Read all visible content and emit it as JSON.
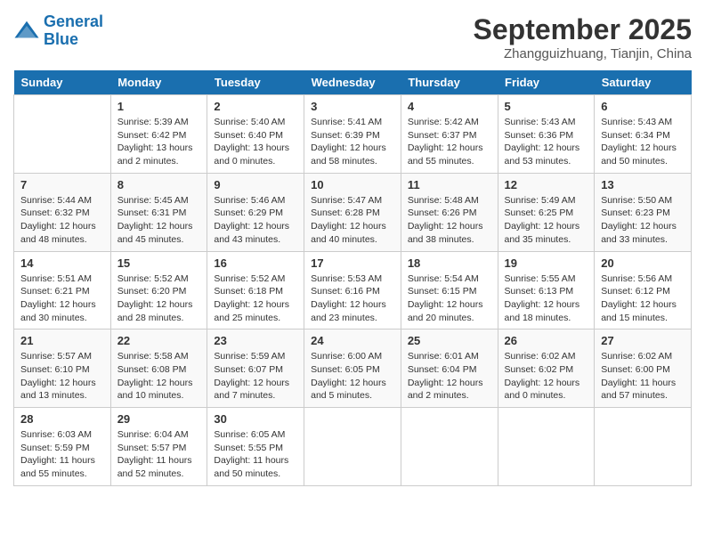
{
  "header": {
    "logo_line1": "General",
    "logo_line2": "Blue",
    "month": "September 2025",
    "location": "Zhangguizhuang, Tianjin, China"
  },
  "days_of_week": [
    "Sunday",
    "Monday",
    "Tuesday",
    "Wednesday",
    "Thursday",
    "Friday",
    "Saturday"
  ],
  "weeks": [
    [
      {
        "day": "",
        "info": ""
      },
      {
        "day": "1",
        "info": "Sunrise: 5:39 AM\nSunset: 6:42 PM\nDaylight: 13 hours\nand 2 minutes."
      },
      {
        "day": "2",
        "info": "Sunrise: 5:40 AM\nSunset: 6:40 PM\nDaylight: 13 hours\nand 0 minutes."
      },
      {
        "day": "3",
        "info": "Sunrise: 5:41 AM\nSunset: 6:39 PM\nDaylight: 12 hours\nand 58 minutes."
      },
      {
        "day": "4",
        "info": "Sunrise: 5:42 AM\nSunset: 6:37 PM\nDaylight: 12 hours\nand 55 minutes."
      },
      {
        "day": "5",
        "info": "Sunrise: 5:43 AM\nSunset: 6:36 PM\nDaylight: 12 hours\nand 53 minutes."
      },
      {
        "day": "6",
        "info": "Sunrise: 5:43 AM\nSunset: 6:34 PM\nDaylight: 12 hours\nand 50 minutes."
      }
    ],
    [
      {
        "day": "7",
        "info": "Sunrise: 5:44 AM\nSunset: 6:32 PM\nDaylight: 12 hours\nand 48 minutes."
      },
      {
        "day": "8",
        "info": "Sunrise: 5:45 AM\nSunset: 6:31 PM\nDaylight: 12 hours\nand 45 minutes."
      },
      {
        "day": "9",
        "info": "Sunrise: 5:46 AM\nSunset: 6:29 PM\nDaylight: 12 hours\nand 43 minutes."
      },
      {
        "day": "10",
        "info": "Sunrise: 5:47 AM\nSunset: 6:28 PM\nDaylight: 12 hours\nand 40 minutes."
      },
      {
        "day": "11",
        "info": "Sunrise: 5:48 AM\nSunset: 6:26 PM\nDaylight: 12 hours\nand 38 minutes."
      },
      {
        "day": "12",
        "info": "Sunrise: 5:49 AM\nSunset: 6:25 PM\nDaylight: 12 hours\nand 35 minutes."
      },
      {
        "day": "13",
        "info": "Sunrise: 5:50 AM\nSunset: 6:23 PM\nDaylight: 12 hours\nand 33 minutes."
      }
    ],
    [
      {
        "day": "14",
        "info": "Sunrise: 5:51 AM\nSunset: 6:21 PM\nDaylight: 12 hours\nand 30 minutes."
      },
      {
        "day": "15",
        "info": "Sunrise: 5:52 AM\nSunset: 6:20 PM\nDaylight: 12 hours\nand 28 minutes."
      },
      {
        "day": "16",
        "info": "Sunrise: 5:52 AM\nSunset: 6:18 PM\nDaylight: 12 hours\nand 25 minutes."
      },
      {
        "day": "17",
        "info": "Sunrise: 5:53 AM\nSunset: 6:16 PM\nDaylight: 12 hours\nand 23 minutes."
      },
      {
        "day": "18",
        "info": "Sunrise: 5:54 AM\nSunset: 6:15 PM\nDaylight: 12 hours\nand 20 minutes."
      },
      {
        "day": "19",
        "info": "Sunrise: 5:55 AM\nSunset: 6:13 PM\nDaylight: 12 hours\nand 18 minutes."
      },
      {
        "day": "20",
        "info": "Sunrise: 5:56 AM\nSunset: 6:12 PM\nDaylight: 12 hours\nand 15 minutes."
      }
    ],
    [
      {
        "day": "21",
        "info": "Sunrise: 5:57 AM\nSunset: 6:10 PM\nDaylight: 12 hours\nand 13 minutes."
      },
      {
        "day": "22",
        "info": "Sunrise: 5:58 AM\nSunset: 6:08 PM\nDaylight: 12 hours\nand 10 minutes."
      },
      {
        "day": "23",
        "info": "Sunrise: 5:59 AM\nSunset: 6:07 PM\nDaylight: 12 hours\nand 7 minutes."
      },
      {
        "day": "24",
        "info": "Sunrise: 6:00 AM\nSunset: 6:05 PM\nDaylight: 12 hours\nand 5 minutes."
      },
      {
        "day": "25",
        "info": "Sunrise: 6:01 AM\nSunset: 6:04 PM\nDaylight: 12 hours\nand 2 minutes."
      },
      {
        "day": "26",
        "info": "Sunrise: 6:02 AM\nSunset: 6:02 PM\nDaylight: 12 hours\nand 0 minutes."
      },
      {
        "day": "27",
        "info": "Sunrise: 6:02 AM\nSunset: 6:00 PM\nDaylight: 11 hours\nand 57 minutes."
      }
    ],
    [
      {
        "day": "28",
        "info": "Sunrise: 6:03 AM\nSunset: 5:59 PM\nDaylight: 11 hours\nand 55 minutes."
      },
      {
        "day": "29",
        "info": "Sunrise: 6:04 AM\nSunset: 5:57 PM\nDaylight: 11 hours\nand 52 minutes."
      },
      {
        "day": "30",
        "info": "Sunrise: 6:05 AM\nSunset: 5:55 PM\nDaylight: 11 hours\nand 50 minutes."
      },
      {
        "day": "",
        "info": ""
      },
      {
        "day": "",
        "info": ""
      },
      {
        "day": "",
        "info": ""
      },
      {
        "day": "",
        "info": ""
      }
    ]
  ]
}
